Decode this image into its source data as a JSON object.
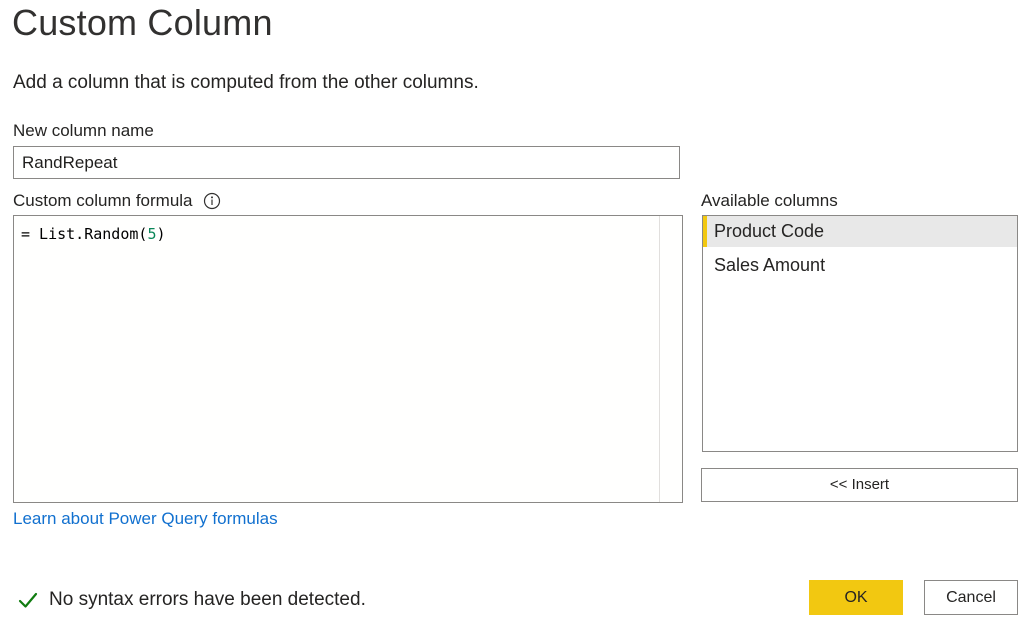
{
  "dialog": {
    "title": "Custom Column",
    "description": "Add a column that is computed from the other columns."
  },
  "new_column": {
    "label": "New column name",
    "value": "RandRepeat"
  },
  "formula": {
    "label": "Custom column formula",
    "info_icon": "info-icon",
    "prefix": "= List.Random(",
    "number": "5",
    "suffix": ")"
  },
  "learn_link": "Learn about Power Query formulas",
  "available_columns": {
    "label": "Available columns",
    "items": [
      "Product Code",
      "Sales Amount"
    ],
    "selected_index": 0
  },
  "insert_button": "<< Insert",
  "status": {
    "icon": "checkmark-icon",
    "text": "No syntax errors have been detected."
  },
  "buttons": {
    "ok": "OK",
    "cancel": "Cancel"
  },
  "colors": {
    "accent": "#f2c811",
    "link": "#1170cf",
    "success": "#107c10"
  }
}
